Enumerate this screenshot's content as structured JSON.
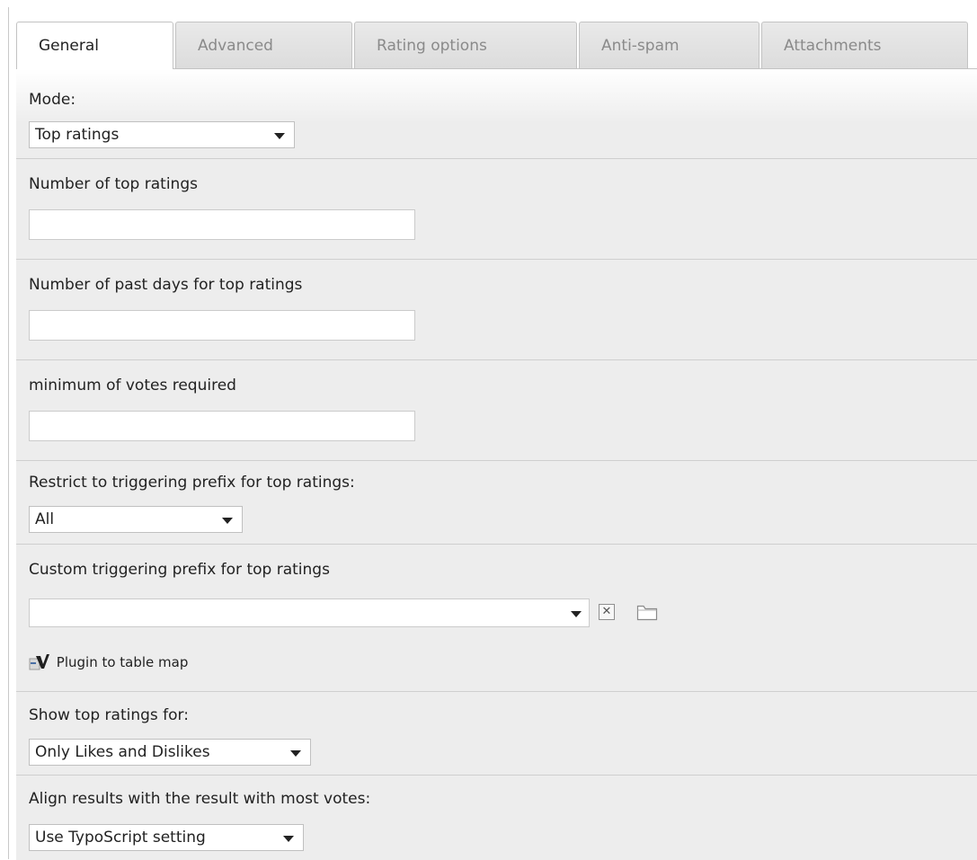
{
  "tabs": [
    {
      "label": "General",
      "active": true
    },
    {
      "label": "Advanced",
      "active": false
    },
    {
      "label": "Rating options",
      "active": false
    },
    {
      "label": "Anti-spam",
      "active": false
    },
    {
      "label": "Attachments",
      "active": false
    }
  ],
  "fields": {
    "mode": {
      "label": "Mode:",
      "value": "Top ratings"
    },
    "num_top": {
      "label": "Number of top ratings",
      "value": ""
    },
    "past_days": {
      "label": "Number of past days for top ratings",
      "value": ""
    },
    "min_votes": {
      "label": "minimum of votes required",
      "value": ""
    },
    "restrict_prefix": {
      "label": "Restrict to triggering prefix for top ratings:",
      "value": "All"
    },
    "custom_prefix": {
      "label": "Custom triggering prefix for top ratings",
      "value": "",
      "link_label": "Plugin to table map"
    },
    "show_for": {
      "label": "Show top ratings for:",
      "value": "Only Likes and Dislikes"
    },
    "align_results": {
      "label": "Align results with the result with most votes:",
      "value": "Use TypoScript setting"
    }
  },
  "icons": {
    "clear": "close-icon",
    "browse": "folder-icon",
    "plugin": "typo3-plugin-icon",
    "dropdown": "chevron-down-icon"
  },
  "colors": {
    "panel_bg": "#ededed",
    "tab_inactive_text": "#8a8a8a",
    "border": "#c3c3c3"
  }
}
